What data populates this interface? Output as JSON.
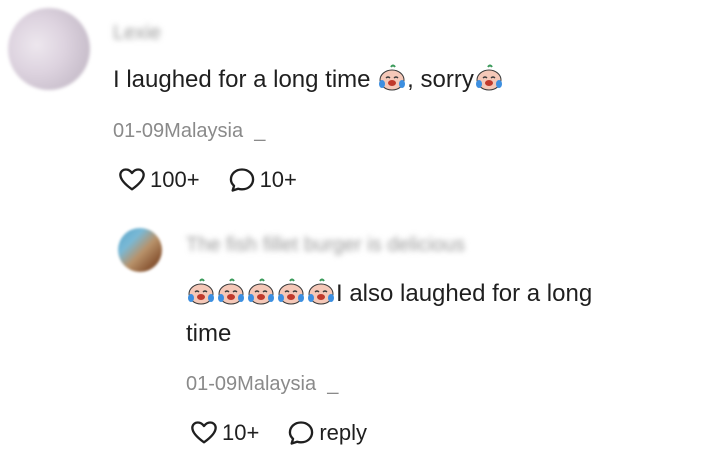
{
  "comment": {
    "author": "Lexie",
    "text_before": "I laughed for a long time ",
    "text_middle": ", sorry",
    "date": "01-09",
    "location": "Malaysia",
    "separator": "_",
    "likes": "100+",
    "replies": "10+"
  },
  "reply": {
    "author": "The fish fillet burger is delicious",
    "text_line1": "I also laughed for a long",
    "text_line2": "time",
    "date": "01-09",
    "location": "Malaysia",
    "separator": "_",
    "likes": "10+",
    "reply_label": "reply"
  },
  "icons": {
    "like": "heart-icon",
    "comment": "comment-bubble-icon",
    "emoji": "crying-laughing-emoji"
  }
}
